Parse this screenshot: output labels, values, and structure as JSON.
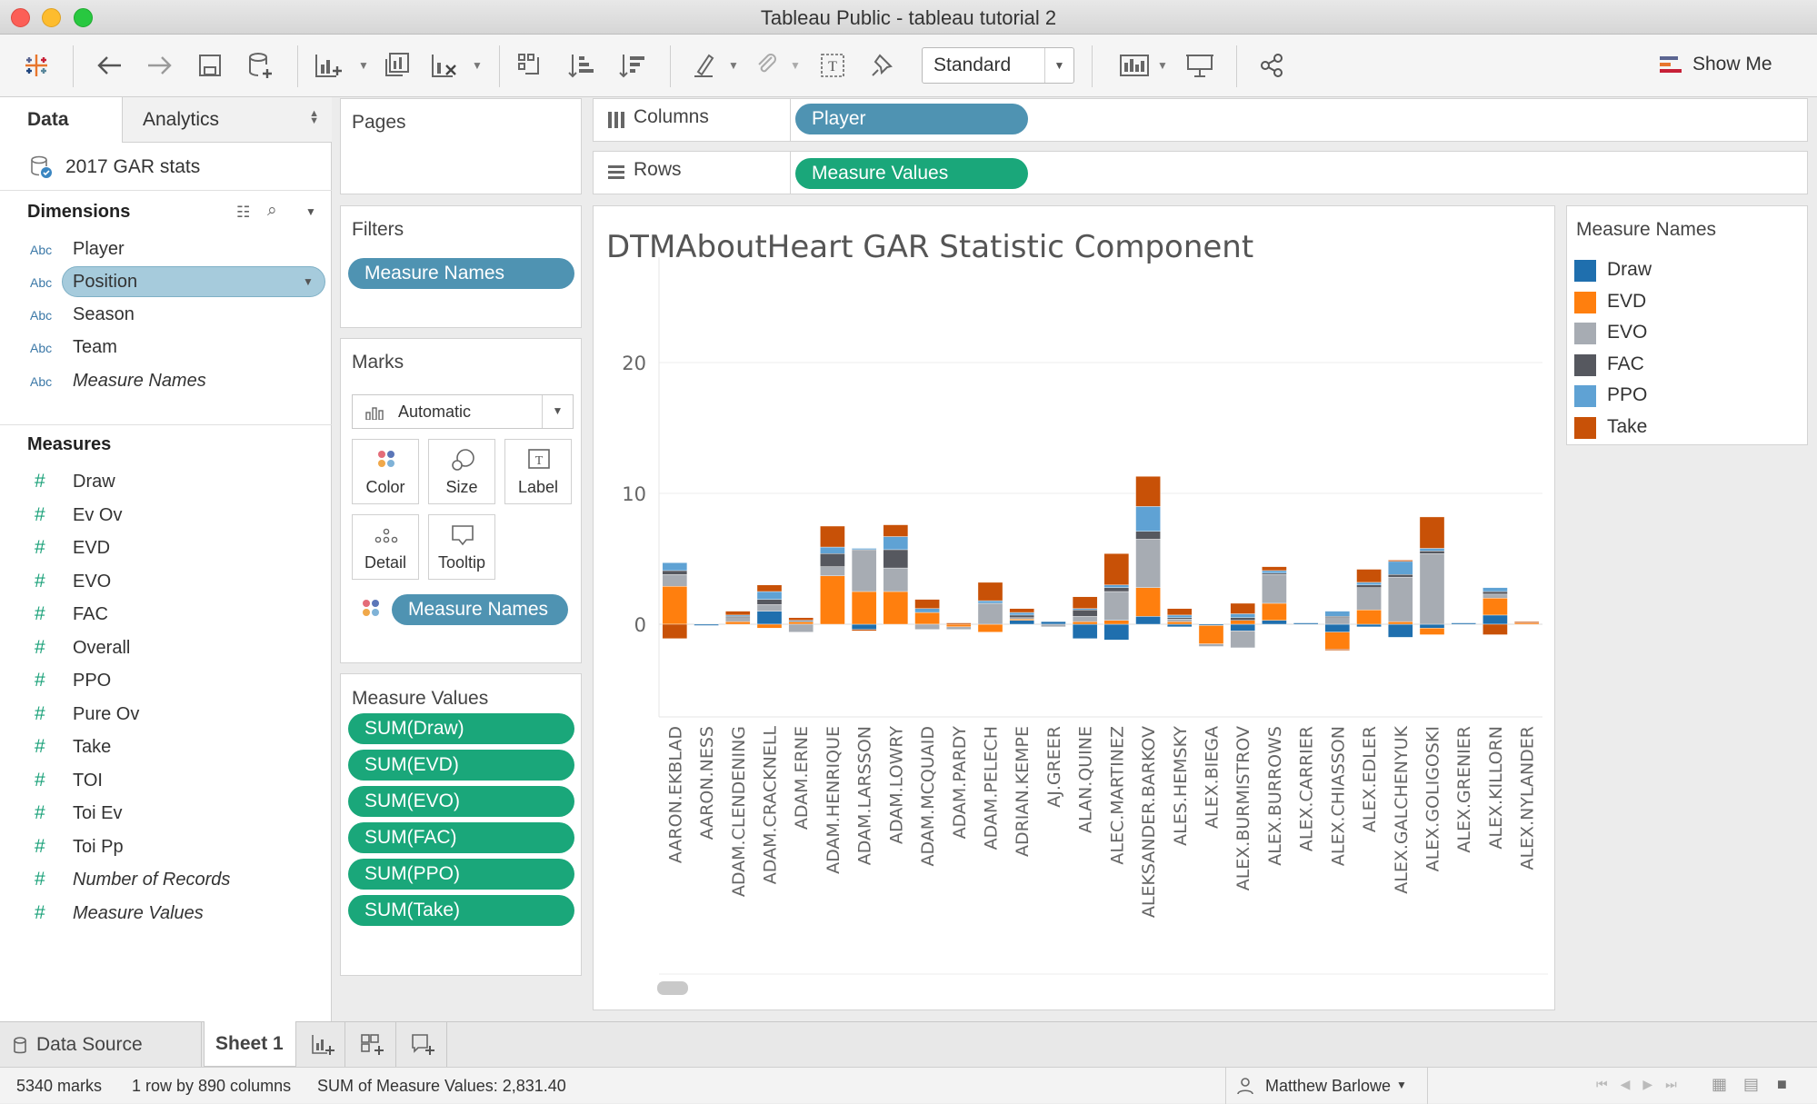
{
  "window": {
    "title": "Tableau Public - tableau tutorial 2"
  },
  "toolbar": {
    "view_select": "Standard",
    "show_me_label": "Show Me"
  },
  "left": {
    "tab_data": "Data",
    "tab_analytics": "Analytics",
    "datasource": "2017 GAR stats",
    "dimensions_header": "Dimensions",
    "dimensions": [
      {
        "type": "Abc",
        "name": "Player"
      },
      {
        "type": "Abc",
        "name": "Position"
      },
      {
        "type": "Abc",
        "name": "Season"
      },
      {
        "type": "Abc",
        "name": "Team"
      },
      {
        "type": "Abc",
        "name": "Measure Names"
      }
    ],
    "measures_header": "Measures",
    "measures": [
      "Draw",
      "Ev Ov",
      "EVD",
      "EVO",
      "FAC",
      "Overall",
      "PPO",
      "Pure Ov",
      "Take",
      "TOI",
      "Toi Ev",
      "Toi Pp",
      "Number of Records",
      "Measure Values"
    ]
  },
  "cards": {
    "pages": "Pages",
    "filters": "Filters",
    "filters_pill": "Measure Names",
    "marks": "Marks",
    "marks_type": "Automatic",
    "mark_buttons": [
      "Color",
      "Size",
      "Label",
      "Detail",
      "Tooltip"
    ],
    "marks_color_pill": "Measure Names",
    "measure_values": "Measure Values",
    "measure_values_pills": [
      "SUM(Draw)",
      "SUM(EVD)",
      "SUM(EVO)",
      "SUM(FAC)",
      "SUM(PPO)",
      "SUM(Take)"
    ]
  },
  "shelves": {
    "columns_label": "Columns",
    "columns_pill": "Player",
    "rows_label": "Rows",
    "rows_pill": "Measure Values"
  },
  "legend": {
    "title": "Measure Names",
    "items": [
      {
        "name": "Draw",
        "color": "#1f6fae"
      },
      {
        "name": "EVD",
        "color": "#ff7f0e"
      },
      {
        "name": "EVO",
        "color": "#a7acb3"
      },
      {
        "name": "FAC",
        "color": "#56585f"
      },
      {
        "name": "PPO",
        "color": "#5fa2d4"
      },
      {
        "name": "Take",
        "color": "#c85107"
      }
    ]
  },
  "chart_data": {
    "type": "bar",
    "stacked": true,
    "title": "DTMAboutHeart GAR Statistic Component",
    "ylim": [
      -7,
      26
    ],
    "yticks": [
      0,
      10,
      20
    ],
    "categories": [
      "AARON.EKBLAD",
      "AARON.NESS",
      "ADAM.CLENDENING",
      "ADAM.CRACKNELL",
      "ADAM.ERNE",
      "ADAM.HENRIQUE",
      "ADAM.LARSSON",
      "ADAM.LOWRY",
      "ADAM.MCQUAID",
      "ADAM.PARDY",
      "ADAM.PELECH",
      "ADRIAN.KEMPE",
      "AJ.GREER",
      "ALAN.QUINE",
      "ALEC.MARTINEZ",
      "ALEKSANDER.BARKOV",
      "ALES.HEMSKY",
      "ALEX.BIEGA",
      "ALEX.BURMISTROV",
      "ALEX.BURROWS",
      "ALEX.CARRIER",
      "ALEX.CHIASSON",
      "ALEX.EDLER",
      "ALEX.GALCHENYUK",
      "ALEX.GOLIGOSKI",
      "ALEX.GRENIER",
      "ALEX.KILLORN",
      "ALEX.NYLANDER"
    ],
    "series": [
      {
        "name": "Draw",
        "values": [
          0,
          -0.1,
          0,
          1.0,
          0,
          0,
          -0.4,
          0,
          0,
          0,
          0,
          0.3,
          0.2,
          -1.1,
          -1.2,
          0.6,
          -0.2,
          -0.1,
          -0.5,
          0.3,
          0.1,
          -0.6,
          -0.2,
          -1.0,
          -0.3,
          0.1,
          0.7,
          0
        ]
      },
      {
        "name": "EVD",
        "values": [
          2.9,
          0,
          0.2,
          -0.3,
          0.2,
          3.7,
          2.5,
          2.5,
          0.9,
          -0.2,
          -0.6,
          0.1,
          0,
          0.2,
          0.3,
          2.2,
          0.2,
          -1.4,
          0.3,
          1.3,
          0,
          -1.3,
          1.1,
          0.2,
          -0.5,
          0,
          1.3,
          0.1
        ]
      },
      {
        "name": "EVO",
        "values": [
          0.9,
          0,
          0.3,
          0.5,
          -0.6,
          0.7,
          3.2,
          1.8,
          -0.4,
          -0.2,
          1.6,
          0.1,
          -0.2,
          0.4,
          2.2,
          3.7,
          0.2,
          -0.2,
          -1.3,
          2.2,
          0,
          0.5,
          1.7,
          3.4,
          5.4,
          0,
          0.3,
          0
        ]
      },
      {
        "name": "FAC",
        "values": [
          0.3,
          0,
          0.1,
          0.4,
          0,
          1.0,
          0,
          1.4,
          0,
          0,
          0,
          0.2,
          0,
          0.5,
          0.3,
          0.6,
          0.1,
          0,
          0.2,
          0.1,
          0,
          0.1,
          0.2,
          0.2,
          0.2,
          0,
          0.2,
          0
        ]
      },
      {
        "name": "PPO",
        "values": [
          0.6,
          0,
          0.1,
          0.6,
          0.1,
          0.5,
          0.1,
          1.0,
          0.3,
          0,
          0.2,
          0.2,
          0,
          0.1,
          0.2,
          1.9,
          0.2,
          0,
          0.3,
          0.2,
          0,
          0.4,
          0.2,
          1.0,
          0.2,
          0,
          0.3,
          0
        ]
      },
      {
        "name": "Take",
        "values": [
          -1.1,
          0,
          0.3,
          0.5,
          0.2,
          1.6,
          -0.1,
          0.9,
          0.7,
          0.1,
          1.4,
          0.3,
          0,
          0.9,
          2.4,
          2.3,
          0.5,
          0,
          0.8,
          0.3,
          0,
          -0.1,
          1.0,
          0.1,
          2.4,
          0,
          -0.8,
          0.1
        ]
      }
    ]
  },
  "bottom_tabs": {
    "data_source": "Data Source",
    "sheet": "Sheet 1"
  },
  "status": {
    "marks": "5340 marks",
    "dims": "1 row by 890 columns",
    "sum": "SUM of Measure Values: 2,831.40",
    "user": "Matthew Barlowe"
  }
}
